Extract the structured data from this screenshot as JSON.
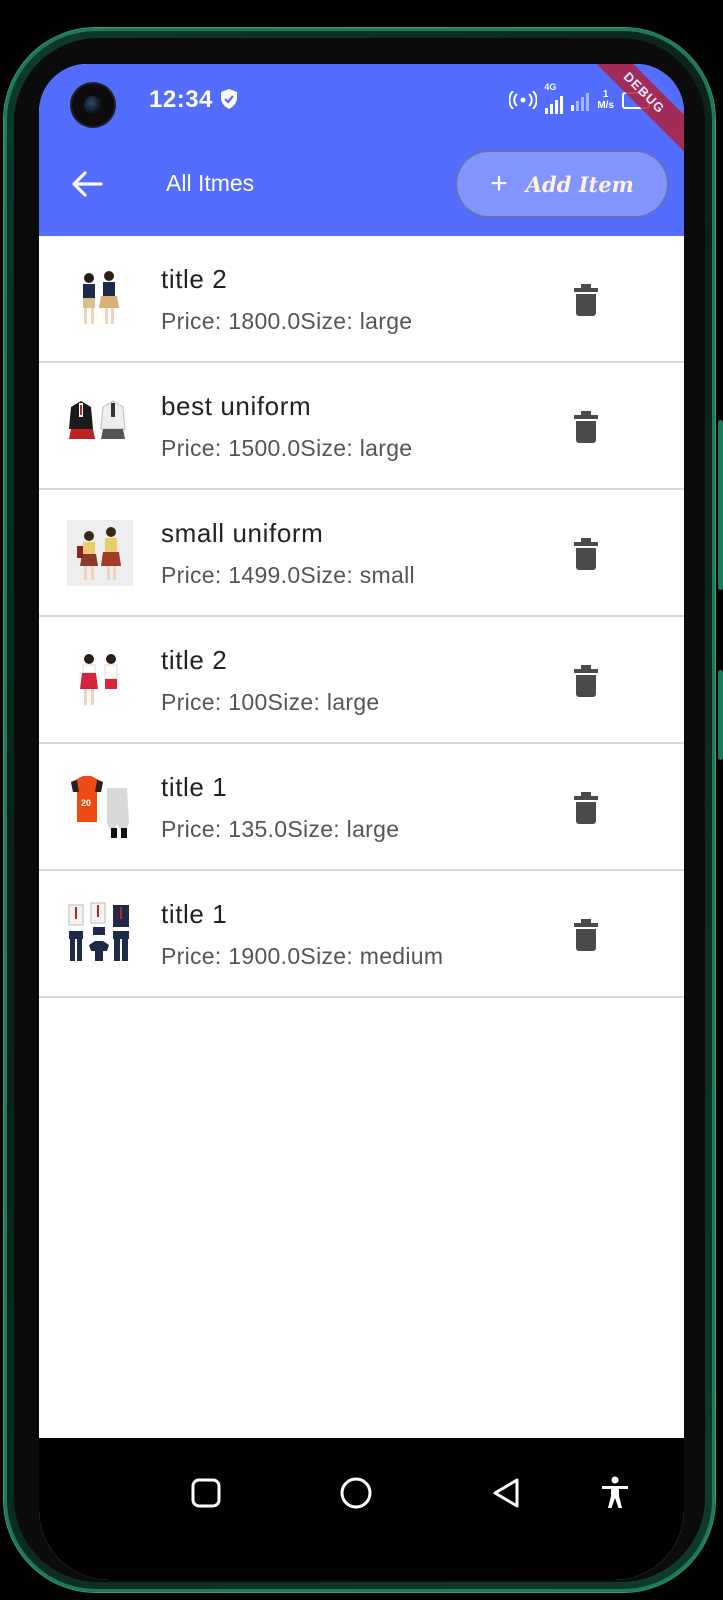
{
  "status_bar": {
    "time": "12:34",
    "network_type": "4G",
    "net_speed_value": "1",
    "net_speed_unit": "M/s"
  },
  "debug_banner": "DEBUG",
  "app_bar": {
    "title": "All Itmes",
    "add_button_label": "Add Item",
    "add_button_icon": "plus-icon",
    "back_icon": "arrow-left-icon",
    "color": "#536DFE"
  },
  "items": [
    {
      "title": "title 2",
      "subtitle": "Price: 1800.0Size: large"
    },
    {
      "title": "best uniform",
      "subtitle": "Price: 1500.0Size: large"
    },
    {
      "title": "small uniform",
      "subtitle": "Price: 1499.0Size: small"
    },
    {
      "title": "title 2",
      "subtitle": "Price: 100Size: large"
    },
    {
      "title": "title 1",
      "subtitle": "Price: 135.0Size: large"
    },
    {
      "title": "title 1",
      "subtitle": "Price: 1900.0Size: medium"
    }
  ],
  "item_action_icon": "trash-icon",
  "nav_bar": {
    "buttons": [
      "square-icon",
      "circle-icon",
      "triangle-back-icon",
      "accessibility-icon"
    ]
  }
}
